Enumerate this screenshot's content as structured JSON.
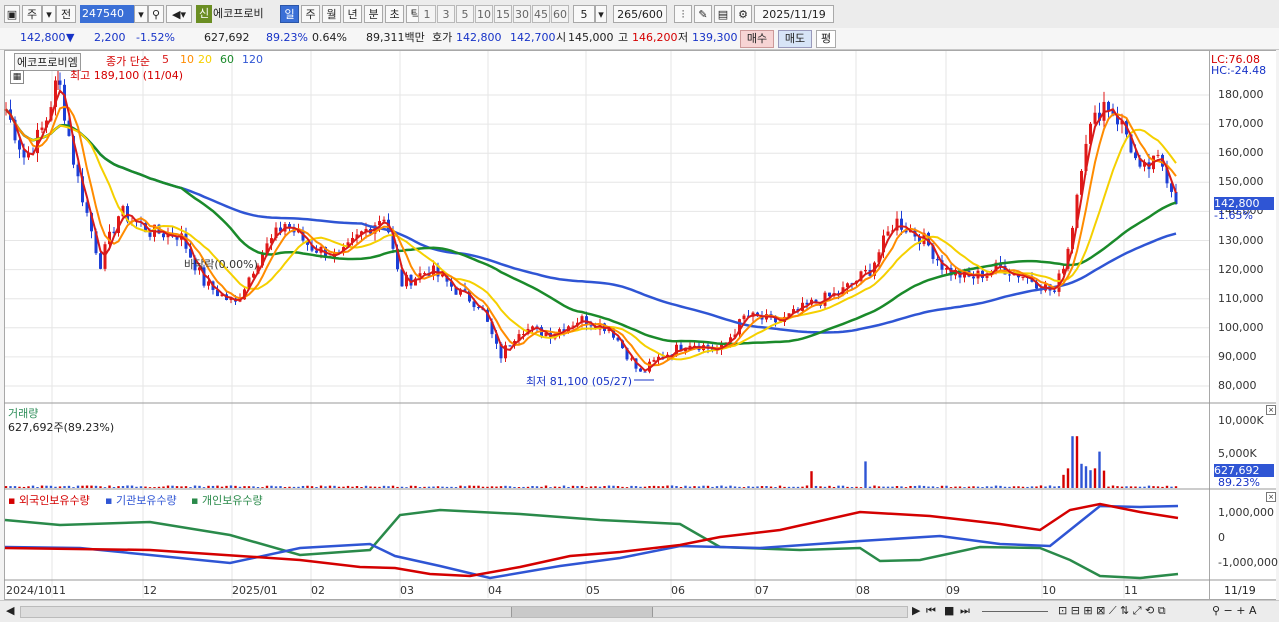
{
  "toolbar": {
    "type_label": "주",
    "prev_label": "전",
    "code": "247540",
    "new_badge": "신",
    "name": "에코프로비",
    "periods": [
      "일",
      "주",
      "월",
      "년",
      "분",
      "초",
      "틱"
    ],
    "active_period": "일",
    "intervals": [
      "1",
      "3",
      "5",
      "10",
      "15",
      "30",
      "45",
      "60"
    ],
    "count_value": "5",
    "range": "265/600",
    "date": "2025/11/19"
  },
  "quote": {
    "price": "142,800",
    "arrow": "▼",
    "change": "2,200",
    "change_pct": "-1.52%",
    "volume": "627,692",
    "vol_ratio": "89.23%",
    "turnover_rate": "0.64%",
    "amount": "89,311백만",
    "bid_label": "호가",
    "ask": "142,800",
    "bid": "142,700",
    "open_label": "시",
    "open": "145,000",
    "high_label": "고",
    "high": "146,200",
    "low_label": "저",
    "low": "139,300",
    "buy_label": "매수",
    "sell_label": "매도",
    "eval_label": "평"
  },
  "legend": {
    "name": "에코프로비엠",
    "ma_title": "종가 단순",
    "ma_periods": [
      "5",
      "10",
      "20",
      "60",
      "120"
    ],
    "ma_colors": [
      "#d81b1b",
      "#ff8c00",
      "#f5d000",
      "#1a8a2a",
      "#2f55d4"
    ]
  },
  "annotations": {
    "high": "최고 189,100 (11/04)",
    "low": "최저 81,100 (05/27)",
    "base": "바닥락(0.00%)"
  },
  "right_axis": {
    "lc": "LC:76.08",
    "hc": "HC:-24.48",
    "price_badge": "142,800",
    "pct_badge": "-1.65%",
    "price_ticks": [
      "180,000",
      "170,000",
      "160,000",
      "150,000",
      "140,000",
      "130,000",
      "120,000",
      "110,000",
      "100,000",
      "90,000",
      "80,000"
    ],
    "vol_ticks": [
      "10,000K",
      "5,000K"
    ],
    "vol_badge": "627,692",
    "vol_pct": "89.23%",
    "hold_ticks": [
      "1,000,000",
      "0",
      "-1,000,000"
    ],
    "last_date": "11/19"
  },
  "volume_panel": {
    "title": "거래량",
    "value": "627,692주(89.23%)"
  },
  "holding_panel": {
    "series": [
      {
        "name": "외국인보유수량",
        "color": "#d40000"
      },
      {
        "name": "기관보유수량",
        "color": "#2f55d4"
      },
      {
        "name": "개인보유수량",
        "color": "#2a8a4a"
      }
    ]
  },
  "x_labels": [
    "2024/10",
    "11",
    "12",
    "2025/01",
    "02",
    "03",
    "04",
    "05",
    "06",
    "07",
    "08",
    "09",
    "10",
    "11"
  ],
  "chart_data": {
    "type": "candlestick",
    "y_range": [
      76000,
      186000
    ],
    "close_5ma_points": [
      [
        0,
        0
      ]
    ]
  }
}
